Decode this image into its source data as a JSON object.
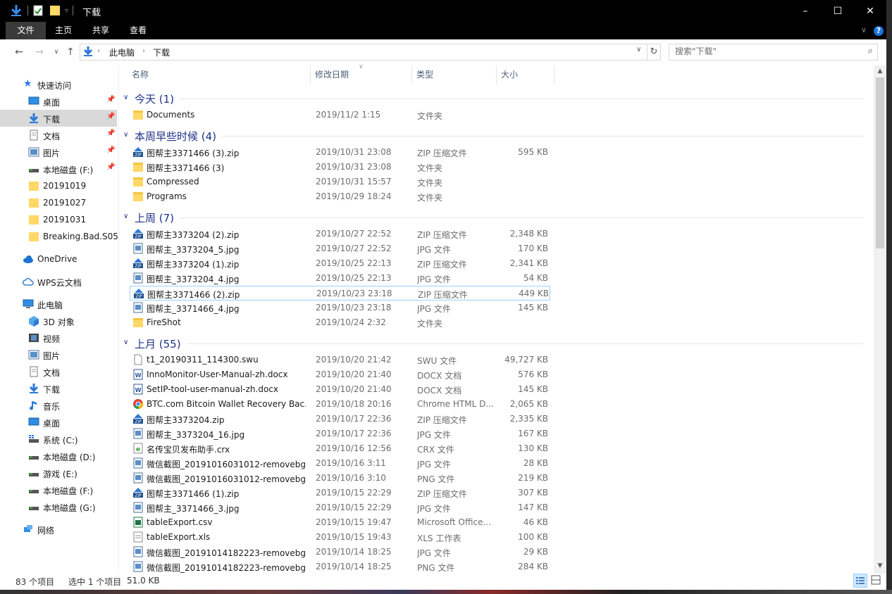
{
  "window": {
    "title": "下载",
    "controls": {
      "minimize": "–",
      "maximize": "☐",
      "close": "✕"
    }
  },
  "ribbon": {
    "tabs": [
      {
        "label": "文件",
        "active": true
      },
      {
        "label": "主页"
      },
      {
        "label": "共享"
      },
      {
        "label": "查看"
      }
    ],
    "help": "?"
  },
  "address": {
    "crumbs": [
      "此电脑",
      "下载"
    ],
    "search_placeholder": "搜索\"下载\""
  },
  "sidebar": {
    "quick_access": "快速访问",
    "quick_items": [
      {
        "label": "桌面",
        "icon": "desktop-icon",
        "pinned": true
      },
      {
        "label": "下载",
        "icon": "download-icon",
        "pinned": true,
        "selected": true
      },
      {
        "label": "文档",
        "icon": "document-icon",
        "pinned": true
      },
      {
        "label": "图片",
        "icon": "pictures-icon",
        "pinned": true
      },
      {
        "label": "本地磁盘 (F:)",
        "icon": "drive-icon",
        "pinned": true
      },
      {
        "label": "20191019",
        "icon": "folder-icon"
      },
      {
        "label": "20191027",
        "icon": "folder-icon"
      },
      {
        "label": "20191031",
        "icon": "folder-icon"
      },
      {
        "label": "Breaking.Bad.S05.",
        "icon": "folder-icon"
      }
    ],
    "onedrive": "OneDrive",
    "wps": "WPS云文档",
    "this_pc": "此电脑",
    "pc_items": [
      {
        "label": "3D 对象",
        "icon": "3d-objects-icon"
      },
      {
        "label": "视频",
        "icon": "video-icon"
      },
      {
        "label": "图片",
        "icon": "pictures-icon"
      },
      {
        "label": "文档",
        "icon": "document-icon"
      },
      {
        "label": "下载",
        "icon": "download-icon"
      },
      {
        "label": "音乐",
        "icon": "music-icon"
      },
      {
        "label": "桌面",
        "icon": "desktop-icon"
      },
      {
        "label": "系统 (C:)",
        "icon": "system-drive-icon"
      },
      {
        "label": "本地磁盘 (D:)",
        "icon": "drive-icon"
      },
      {
        "label": "游戏 (E:)",
        "icon": "drive-icon"
      },
      {
        "label": "本地磁盘 (F:)",
        "icon": "drive-icon"
      },
      {
        "label": "本地磁盘 (G:)",
        "icon": "drive-icon"
      }
    ],
    "network": "网络"
  },
  "columns": {
    "name": "名称",
    "date": "修改日期",
    "type": "类型",
    "size": "大小"
  },
  "groups": [
    {
      "label": "今天 (1)",
      "items": [
        {
          "name": "Documents",
          "date": "2019/11/2 1:15",
          "type": "文件夹",
          "size": "",
          "icon": "folder"
        }
      ]
    },
    {
      "label": "本周早些时候 (4)",
      "items": [
        {
          "name": "图帮主3371466 (3).zip",
          "date": "2019/10/31 23:08",
          "type": "ZIP 压缩文件",
          "size": "595 KB",
          "icon": "zip"
        },
        {
          "name": "图帮主3371466 (3)",
          "date": "2019/10/31 23:08",
          "type": "文件夹",
          "size": "",
          "icon": "folder"
        },
        {
          "name": "Compressed",
          "date": "2019/10/31 15:57",
          "type": "文件夹",
          "size": "",
          "icon": "folder"
        },
        {
          "name": "Programs",
          "date": "2019/10/29 18:24",
          "type": "文件夹",
          "size": "",
          "icon": "folder"
        }
      ]
    },
    {
      "label": "上周 (7)",
      "items": [
        {
          "name": "图帮主3373204 (2).zip",
          "date": "2019/10/27 22:52",
          "type": "ZIP 压缩文件",
          "size": "2,348 KB",
          "icon": "zip"
        },
        {
          "name": "图帮主_3373204_5.jpg",
          "date": "2019/10/27 22:52",
          "type": "JPG 文件",
          "size": "170 KB",
          "icon": "image"
        },
        {
          "name": "图帮主3373204 (1).zip",
          "date": "2019/10/25 22:13",
          "type": "ZIP 压缩文件",
          "size": "2,341 KB",
          "icon": "zip"
        },
        {
          "name": "图帮主_3373204_4.jpg",
          "date": "2019/10/25 22:13",
          "type": "JPG 文件",
          "size": "54 KB",
          "icon": "image"
        },
        {
          "name": "图帮主3371466 (2).zip",
          "date": "2019/10/23 23:18",
          "type": "ZIP 压缩文件",
          "size": "449 KB",
          "icon": "zip",
          "selected": true
        },
        {
          "name": "图帮主_3371466_4.jpg",
          "date": "2019/10/23 23:18",
          "type": "JPG 文件",
          "size": "145 KB",
          "icon": "image"
        },
        {
          "name": "FireShot",
          "date": "2019/10/24 2:32",
          "type": "文件夹",
          "size": "",
          "icon": "folder"
        }
      ]
    },
    {
      "label": "上月 (55)",
      "items": [
        {
          "name": "t1_20190311_114300.swu",
          "date": "2019/10/20 21:42",
          "type": "SWU 文件",
          "size": "49,727 KB",
          "icon": "blank"
        },
        {
          "name": "InnoMonitor-User-Manual-zh.docx",
          "date": "2019/10/20 21:40",
          "type": "DOCX 文档",
          "size": "576 KB",
          "icon": "docx"
        },
        {
          "name": "SetIP-tool-user-manual-zh.docx",
          "date": "2019/10/20 21:40",
          "type": "DOCX 文档",
          "size": "145 KB",
          "icon": "docx"
        },
        {
          "name": "BTC.com Bitcoin Wallet Recovery Bac...",
          "date": "2019/10/18 20:16",
          "type": "Chrome HTML D...",
          "size": "2,065 KB",
          "icon": "chrome"
        },
        {
          "name": "图帮主3373204.zip",
          "date": "2019/10/17 22:36",
          "type": "ZIP 压缩文件",
          "size": "2,335 KB",
          "icon": "zip"
        },
        {
          "name": "图帮主_3373204_16.jpg",
          "date": "2019/10/17 22:36",
          "type": "JPG 文件",
          "size": "167 KB",
          "icon": "image"
        },
        {
          "name": "名传宝贝发布助手.crx",
          "date": "2019/10/16 12:56",
          "type": "CRX 文件",
          "size": "130 KB",
          "icon": "crx"
        },
        {
          "name": "微信截图_20191016031012-removebg...",
          "date": "2019/10/16 3:11",
          "type": "JPG 文件",
          "size": "28 KB",
          "icon": "image"
        },
        {
          "name": "微信截图_20191016031012-removebg...",
          "date": "2019/10/16 3:10",
          "type": "PNG 文件",
          "size": "219 KB",
          "icon": "image"
        },
        {
          "name": "图帮主3371466 (1).zip",
          "date": "2019/10/15 22:29",
          "type": "ZIP 压缩文件",
          "size": "307 KB",
          "icon": "zip"
        },
        {
          "name": "图帮主_3371466_3.jpg",
          "date": "2019/10/15 22:29",
          "type": "JPG 文件",
          "size": "147 KB",
          "icon": "image"
        },
        {
          "name": "tableExport.csv",
          "date": "2019/10/15 19:47",
          "type": "Microsoft Office...",
          "size": "46 KB",
          "icon": "csv"
        },
        {
          "name": "tableExport.xls",
          "date": "2019/10/15 19:43",
          "type": "XLS 工作表",
          "size": "100 KB",
          "icon": "xls"
        },
        {
          "name": "微信截图_20191014182223-removebg...",
          "date": "2019/10/14 18:25",
          "type": "JPG 文件",
          "size": "29 KB",
          "icon": "image"
        },
        {
          "name": "微信截图_20191014182223-removebg...",
          "date": "2019/10/14 18:25",
          "type": "PNG 文件",
          "size": "284 KB",
          "icon": "image"
        }
      ]
    }
  ],
  "status": {
    "count": "83 个项目",
    "selection": "选中 1 个项目",
    "size": "51.0 KB"
  },
  "colors": {
    "accent": "#1e3287",
    "selection_border": "#99d1ff",
    "folder": "#ffd866"
  }
}
